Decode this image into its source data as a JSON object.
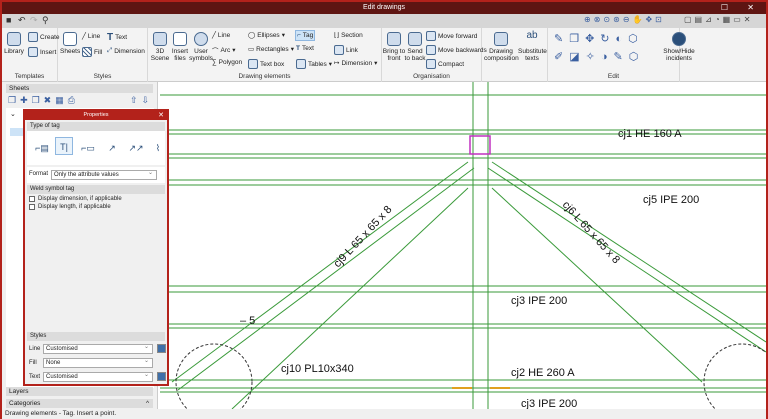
{
  "window": {
    "title": "Edit drawings"
  },
  "ribbon": {
    "templates": {
      "label": "Templates",
      "library": "Library",
      "create": "Create",
      "insert": "Insert"
    },
    "styles": {
      "label": "Styles",
      "sheets": "Sheets",
      "line": "Line",
      "fill": "Fill",
      "text": "Text",
      "dimension": "Dimension"
    },
    "drawing": {
      "label": "Drawing elements",
      "scene3d": "3D Scene",
      "insert_files": "Insert files",
      "user_symbols": "User symbols",
      "line": "Line",
      "arc": "Arc",
      "polygon": "Polygon",
      "ellipses": "Ellipses",
      "rectangles": "Rectangles",
      "text_box": "Text box",
      "tag": "Tag",
      "text": "Text",
      "tables": "Tables",
      "section": "Section",
      "link": "Link",
      "dimension": "Dimension"
    },
    "organisation": {
      "label": "Organisation",
      "bring_front": "Bring to front",
      "send_back": "Send to back",
      "move_forward": "Move forward",
      "move_backwards": "Move backwards",
      "compact": "Compact"
    },
    "composition": {
      "drawing_composition": "Drawing composition",
      "substitute_texts": "Substitute texts"
    },
    "edit": {
      "label": "Edit"
    },
    "incidents": {
      "show_hide": "Show/Hide incidents"
    }
  },
  "left": {
    "sheets": "Sheets",
    "layers": "Layers",
    "categories": "Categories"
  },
  "properties": {
    "title": "Properties",
    "type_of_tag": "Type of tag",
    "format_label": "Format",
    "format_value": "Only the attribute values",
    "weld_tag": "Weld symbol tag",
    "display_dimension": "Display dimension, if applicable",
    "display_length": "Display length, if applicable",
    "styles": "Styles",
    "line_label": "Line",
    "line_value": "Customised",
    "fill_label": "Fill",
    "fill_value": "None",
    "text_label": "Text",
    "text_value": "Customised"
  },
  "drawing": {
    "labels": [
      "cj1 HE 160 A",
      "cj5 IPE 200",
      "cj9 L 65 x 65 x 8",
      "cj6 L 65 x 65 x 8",
      "cj3 IPE 200",
      "– 5",
      "cj10 PL10x340",
      "cj2 HE 260 A",
      "cj3 IPE 200"
    ],
    "line_color": "#3a9a3a"
  },
  "status": "Drawing elements - Tag. Insert a point."
}
